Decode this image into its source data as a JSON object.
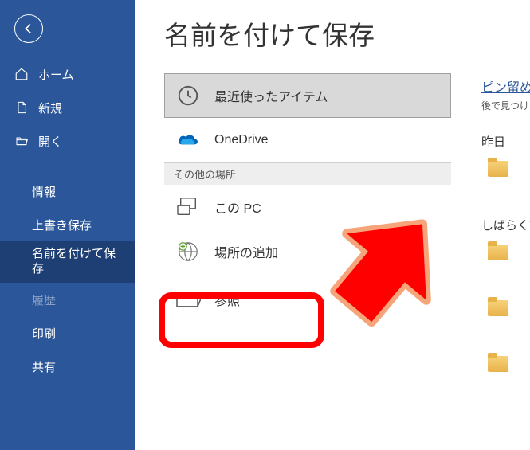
{
  "sidebar": {
    "home": "ホーム",
    "new": "新規",
    "open": "開く",
    "info": "情報",
    "save": "上書き保存",
    "saveas": "名前を付けて保存",
    "history": "履歴",
    "print": "印刷",
    "share": "共有"
  },
  "main": {
    "title": "名前を付けて保存",
    "recent": "最近使ったアイテム",
    "onedrive": "OneDrive",
    "other_heading": "その他の場所",
    "thispc": "この PC",
    "addplace": "場所の追加",
    "browse": "参照"
  },
  "right": {
    "pin_title": "ピン留め",
    "pin_sub": "後で見つけ",
    "yesterday": "昨日",
    "longago": "しばらく前"
  }
}
